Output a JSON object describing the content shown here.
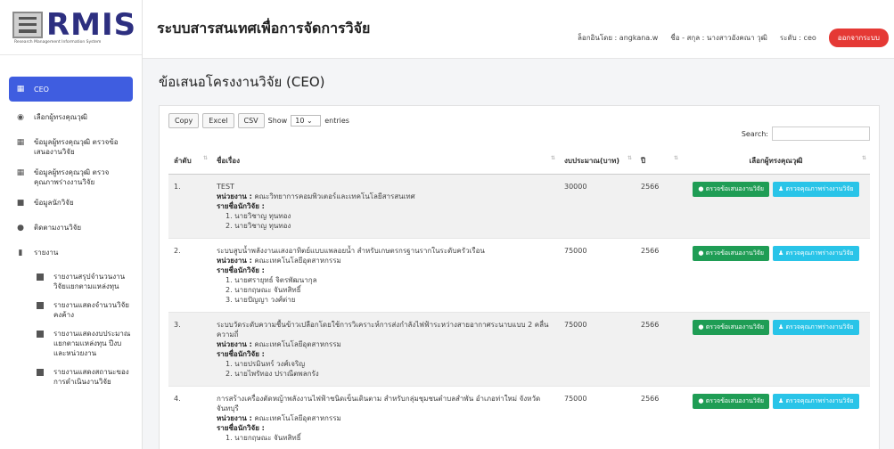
{
  "brand": {
    "logo_text": "RMIS",
    "logo_sub": "Research Management Information System"
  },
  "header": {
    "title": "ระบบสารสนเทศเพื่อการจัดการวิจัย",
    "login": "ล็อกอินโดย : angkana.w",
    "name": "ชื่อ - สกุล : นางสาวอังคณา วุฒิ",
    "level": "ระดับ : ceo",
    "logout": "ออกจากระบบ"
  },
  "sidebar": {
    "items": [
      {
        "label": "CEO",
        "icon": "grid-icon"
      },
      {
        "label": "เลือกผู้ทรงคุณวุฒิ",
        "icon": "disc-icon"
      },
      {
        "label": "ข้อมูลผู้ทรงคุณวุฒิ ตรวจข้อเสนองานวิจัย",
        "icon": "grid-icon"
      },
      {
        "label": "ข้อมูลผู้ทรงคุณวุฒิ ตรวจคุณภาพร่างงานวิจัย",
        "icon": "grid-icon"
      },
      {
        "label": "ข้อมูลนักวิจัย",
        "icon": "briefcase-icon"
      },
      {
        "label": "ติดตามงานวิจัย",
        "icon": "disc-icon"
      },
      {
        "label": "รายงาน",
        "icon": "bar-chart-icon"
      }
    ],
    "sub_items": [
      {
        "label": "รายงานสรุปจำนวนงานวิจัยแยกตามแหล่งทุน"
      },
      {
        "label": "รายงานแสดงจำนวนวิจัยคงค้าง"
      },
      {
        "label": "รายงานแสดงงบประมาณแยกตามแหล่งทุน ปีงบ และหน่วยงาน"
      },
      {
        "label": "รายงานแสดงสถานะของการดำเนินงานวิจัย"
      }
    ]
  },
  "main": {
    "page_title": "ข้อเสนอโครงงานวิจัย (CEO)",
    "buttons": {
      "copy": "Copy",
      "excel": "Excel",
      "csv": "CSV"
    },
    "show_label": "Show",
    "show_value": "10",
    "entries_label": "entries",
    "search_label": "Search:",
    "columns": [
      "ลำดับ",
      "ชื่อเรื่อง",
      "งบประมาณ(บาท)",
      "ปี",
      "เลือกผู้ทรงคุณวุฒิ"
    ],
    "unit_label": "หน่วยงาน :",
    "researchers_label": "รายชื่อนักวิจัย :",
    "action_review": "ตรวจข้อเสนองานวิจัย",
    "action_quality": "ตรวจคุณภาพร่างงานวิจัย",
    "rows": [
      {
        "no": "1.",
        "title": "TEST",
        "unit": "คณะวิทยาการคอมพิวเตอร์และเทคโนโลยีสารสนเทศ",
        "researchers": [
          "1. นายวิชาญ ทุนทอง",
          "2. นายวิชาญ ทุนทอง"
        ],
        "budget": "30000",
        "year": "2566"
      },
      {
        "no": "2.",
        "title": "ระบบสูบน้ำพลังงานแสงอาทิตย์แบบแพลอยน้ำ สำหรับเกษตรกรฐานรากในระดับครัวเรือน",
        "unit": "คณะเทคโนโลยีอุตสาหกรรม",
        "researchers": [
          "1. นายศรายุทธ์ จิตรพัฒนากุล",
          "2. นายกฤษณะ จันทสิทธิ์",
          "3. นายปัญญา วงศ์ต่าย"
        ],
        "budget": "75000",
        "year": "2566"
      },
      {
        "no": "3.",
        "title": "ระบบวัดระดับความชื้นข้าวเปลือกโดยใช้การวิเคราะห์การส่งกำลังไฟฟ้าระหว่างสายอากาศระนาบแบบ 2 คลื่นความถี่",
        "unit": "คณะเทคโนโลยีอุตสาหกรรม",
        "researchers": [
          "1. นายปรมินทร์ วงศ์เจริญ",
          "2. นายไพรัทอง ปราณีตพลกรัง"
        ],
        "budget": "75000",
        "year": "2566"
      },
      {
        "no": "4.",
        "title": "การสร้างเครื่องตัดหญ้าพลังงานไฟฟ้าชนิดเข็นเดินตาม สำหรับกลุ่มชุมชนตำบลสำพัน อำเภอท่าใหม่ จังหวัดจันทบุรี",
        "unit": "คณะเทคโนโลยีอุตสาหกรรม",
        "researchers": [
          "1. นายกฤษณะ จันทสิทธิ์"
        ],
        "budget": "75000",
        "year": "2566"
      }
    ]
  },
  "colors": {
    "primary": "#3f5de0",
    "logout": "#e53935",
    "green": "#1f9d55",
    "cyan": "#29c4e8"
  }
}
